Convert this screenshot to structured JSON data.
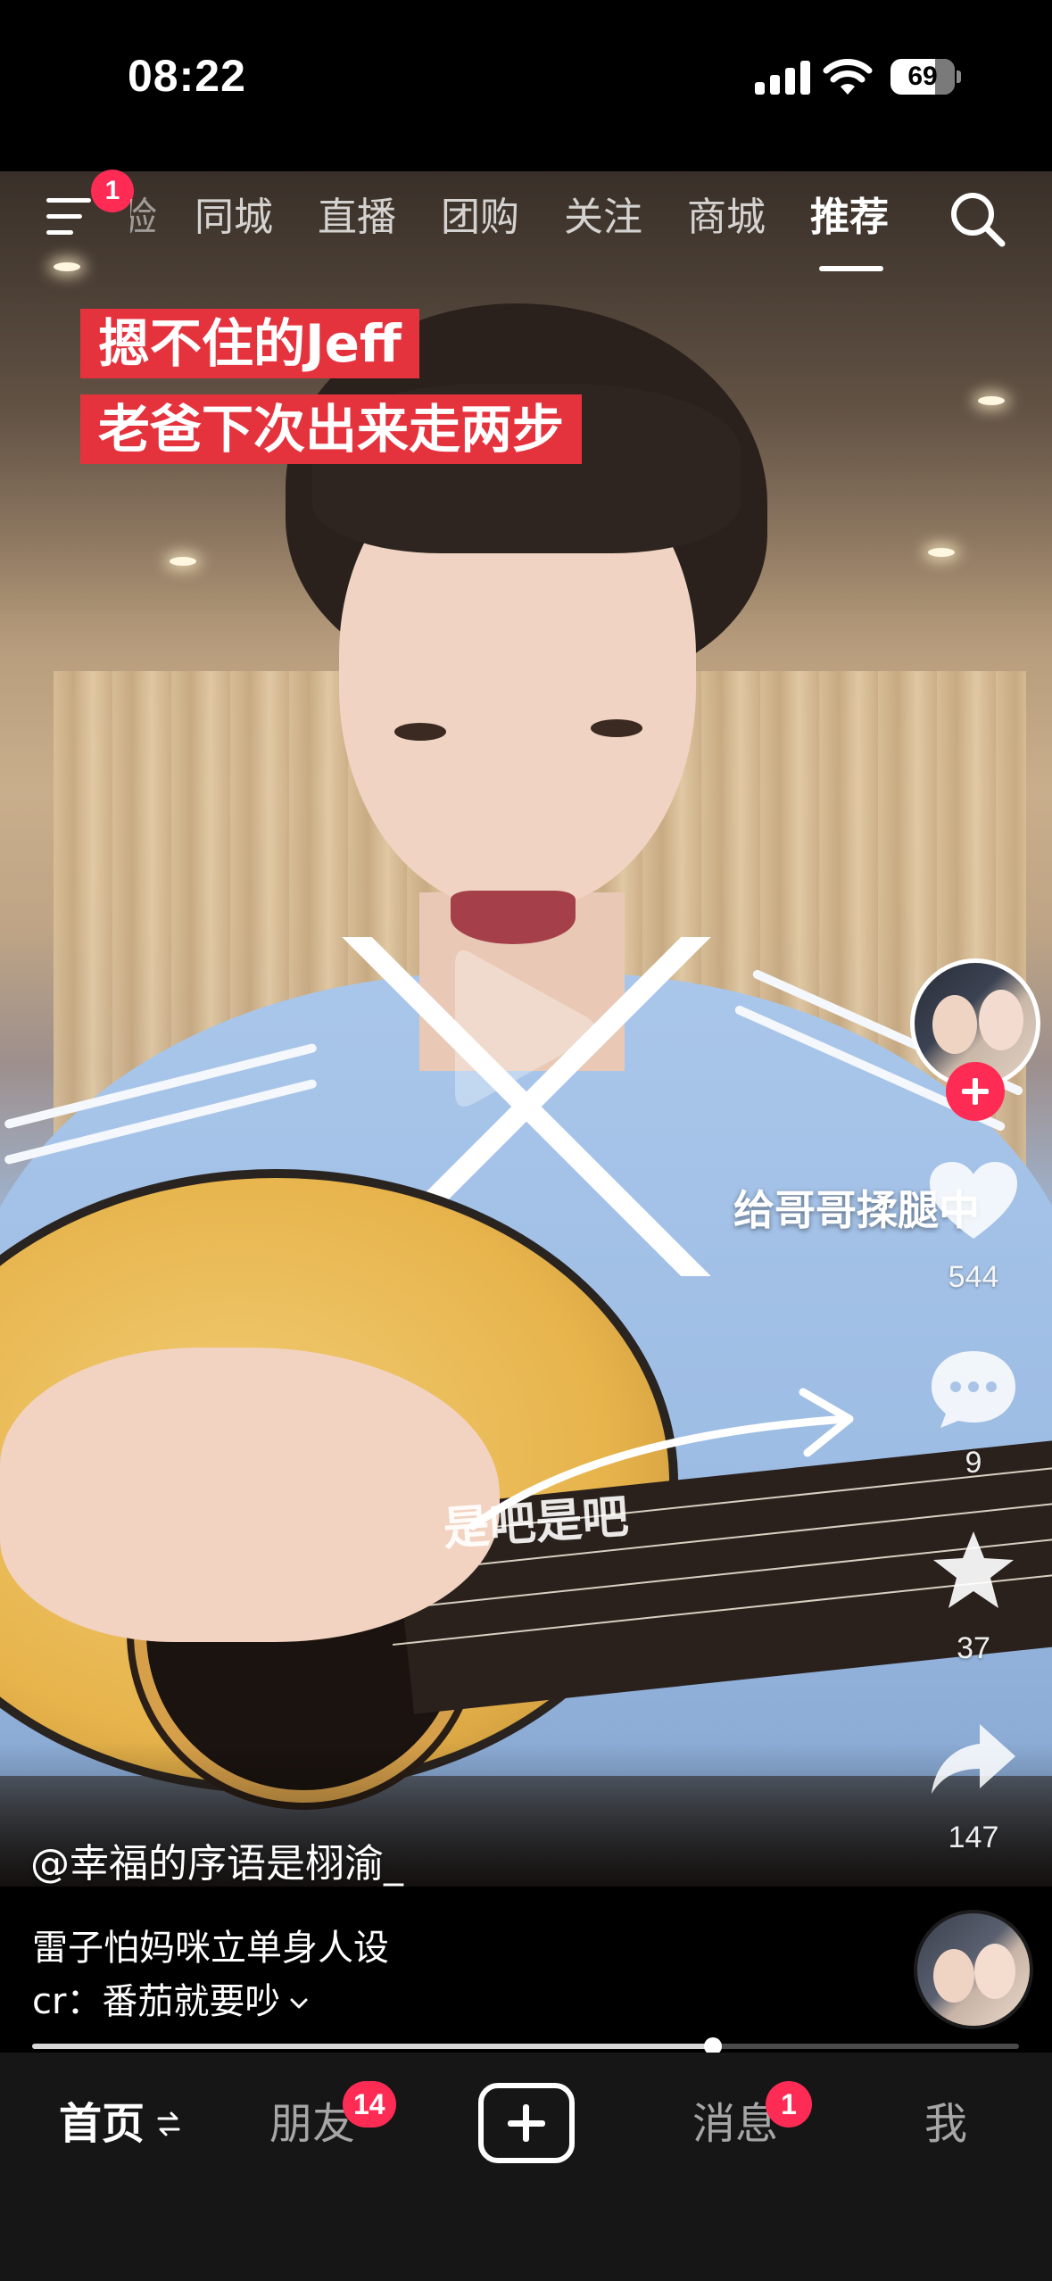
{
  "status_bar": {
    "time": "08:22",
    "battery": "69",
    "battery_level": 0.69
  },
  "top_nav": {
    "menu_badge": "1",
    "partial_tab": "经验",
    "tabs": [
      {
        "label": "同城"
      },
      {
        "label": "直播"
      },
      {
        "label": "团购"
      },
      {
        "label": "关注"
      },
      {
        "label": "商城"
      },
      {
        "label": "推荐"
      }
    ],
    "active_tab": "推荐"
  },
  "video": {
    "caption_line1": "摁不住的Jeff",
    "caption_line2": "老爸下次出来走两步",
    "side_caption": "给哥哥揉腿中",
    "in_video_text": "是吧是吧",
    "author_handle": "@幸福的序语是栩渝_"
  },
  "actions": {
    "likes": "544",
    "comments": "9",
    "favorites": "37",
    "shares": "147"
  },
  "description": {
    "title": "雷子怕妈咪立单身人设",
    "credit": "cr：番茄就要吵"
  },
  "progress": {
    "fraction": 0.69
  },
  "tab_bar": {
    "home": "首页",
    "friends": "朋友",
    "friends_badge": "14",
    "messages": "消息",
    "messages_badge": "1",
    "me": "我"
  },
  "colors": {
    "accent": "#fe2c55",
    "caption_bg": "#e5333e",
    "tabbar_bg": "#161616"
  }
}
